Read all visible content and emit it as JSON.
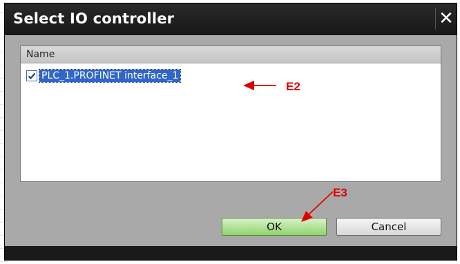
{
  "dialog": {
    "title": "Select IO controller",
    "close_glyph": "✕",
    "list": {
      "column_header": "Name",
      "items": [
        {
          "label": "PLC_1.PROFINET interface_1",
          "checked": true,
          "selected": true
        }
      ]
    },
    "buttons": {
      "ok_label": "OK",
      "cancel_label": "Cancel"
    }
  },
  "annotations": [
    {
      "label": "E2",
      "color": "#e00000"
    },
    {
      "label": "E3",
      "color": "#e00000"
    }
  ],
  "colors": {
    "titlebar": "#1f1f1f",
    "body": "#a9a9a9",
    "selection": "#3166c8",
    "ok_button": "#8fd36d"
  }
}
